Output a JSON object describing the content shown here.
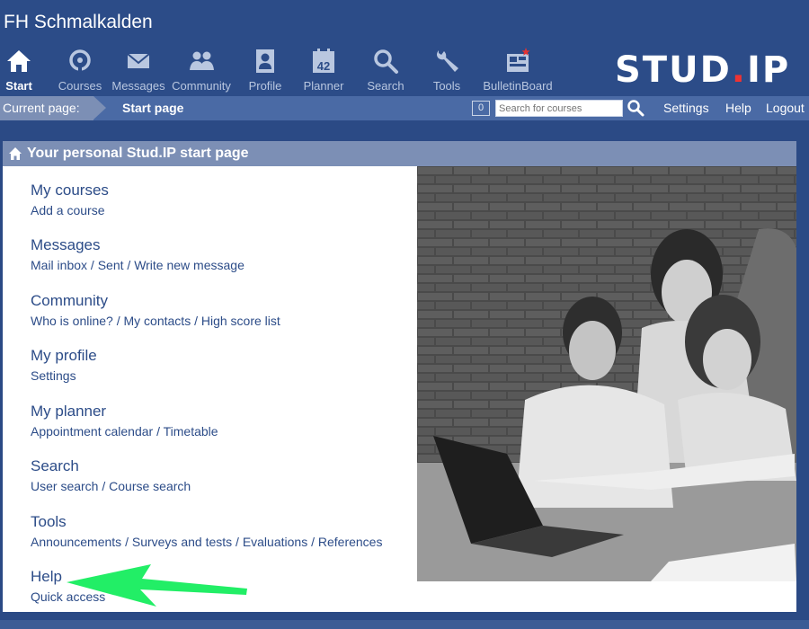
{
  "header": {
    "site_title": "FH Schmalkalden",
    "nav": [
      {
        "label": "Start",
        "icon": "home-icon",
        "active": true
      },
      {
        "label": "Courses",
        "icon": "courses-icon"
      },
      {
        "label": "Messages",
        "icon": "envelope-icon"
      },
      {
        "label": "Community",
        "icon": "people-icon"
      },
      {
        "label": "Profile",
        "icon": "profile-icon"
      },
      {
        "label": "Planner",
        "icon": "calendar-icon",
        "badge": "42"
      },
      {
        "label": "Search",
        "icon": "magnifier-icon"
      },
      {
        "label": "Tools",
        "icon": "wrench-icon"
      },
      {
        "label": "BulletinBoard",
        "icon": "bulletin-board-icon"
      }
    ],
    "logo": {
      "part1": "STUD",
      "dot": ".",
      "part2": "IP"
    }
  },
  "breadcrumb": {
    "label": "Current page:",
    "current": "Start page",
    "course_count": "0",
    "search_placeholder": "Search for courses",
    "links": [
      "Settings",
      "Help",
      "Logout"
    ]
  },
  "main": {
    "title": "Your personal Stud.IP start page",
    "sections": [
      {
        "title": "My courses",
        "links": [
          "Add a course"
        ]
      },
      {
        "title": "Messages",
        "links": [
          "Mail inbox",
          "Sent",
          "Write new message"
        ]
      },
      {
        "title": "Community",
        "links": [
          "Who is online?",
          "My contacts",
          "High score list"
        ]
      },
      {
        "title": "My profile",
        "links": [
          "Settings"
        ]
      },
      {
        "title": "My planner",
        "links": [
          "Appointment calendar",
          "Timetable"
        ]
      },
      {
        "title": "Search",
        "links": [
          "User search",
          "Course search"
        ]
      },
      {
        "title": "Tools",
        "links": [
          "Announcements",
          "Surveys and tests",
          "Evaluations",
          "References"
        ]
      },
      {
        "title": "Help",
        "links": [
          "Quick access"
        ]
      }
    ]
  },
  "colors": {
    "header_bg": "#2c4c88",
    "crumb_bg": "#4a6aa5",
    "box_header_bg": "#7c8fb5",
    "link_color": "#2c4c88",
    "logo_dot": "#e33333",
    "arrow_green": "#22ee66"
  }
}
